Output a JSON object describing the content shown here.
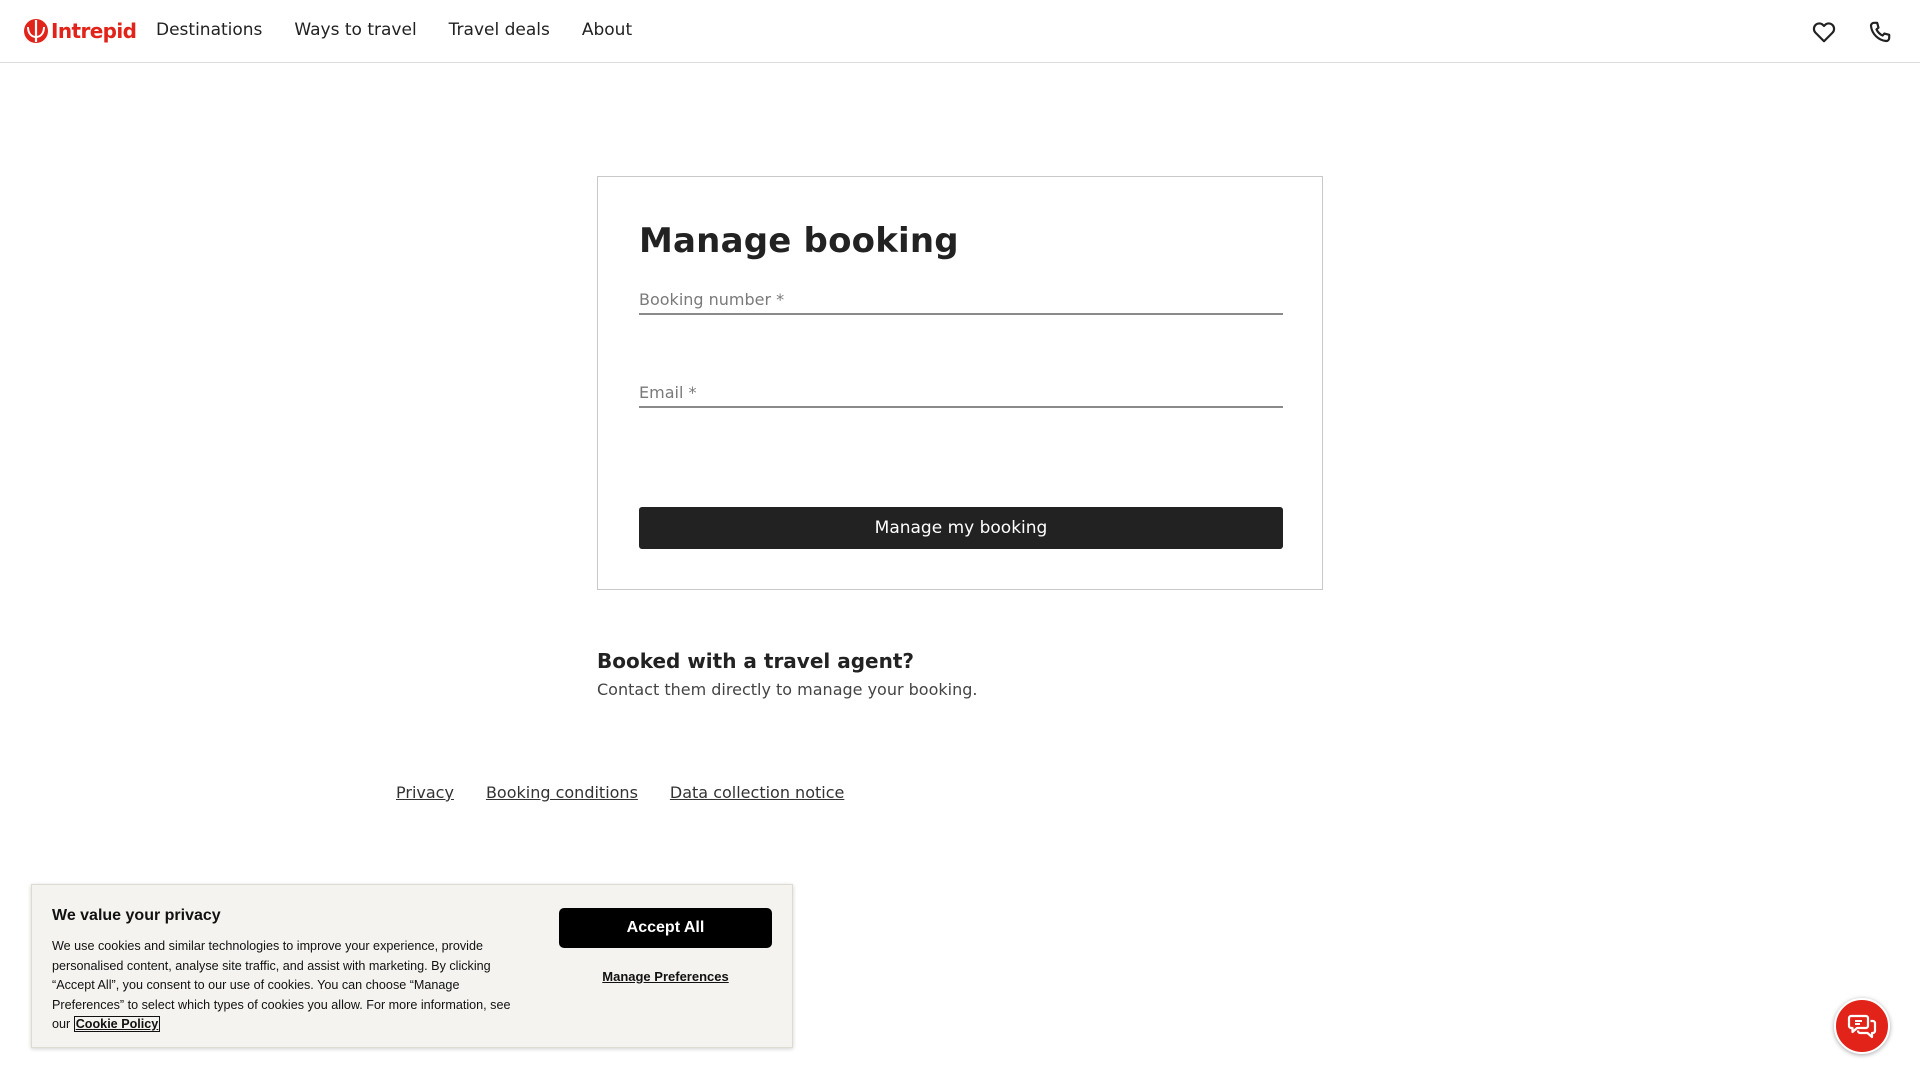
{
  "header": {
    "logo_text": "Intrepid",
    "nav": [
      {
        "label": "Destinations"
      },
      {
        "label": "Ways to travel"
      },
      {
        "label": "Travel deals"
      },
      {
        "label": "About"
      }
    ],
    "icons": [
      "heart-icon",
      "phone-icon"
    ]
  },
  "booking": {
    "title": "Manage booking",
    "booking_number_placeholder": "Booking number *",
    "booking_number_value": "",
    "email_placeholder": "Email *",
    "email_value": "",
    "submit_label": "Manage my booking"
  },
  "agent": {
    "heading": "Booked with a travel agent?",
    "text": "Contact them directly to manage your booking."
  },
  "footer": {
    "links": [
      {
        "label": "Privacy"
      },
      {
        "label": "Booking conditions"
      },
      {
        "label": "Data collection notice"
      }
    ]
  },
  "cookie": {
    "title": "We value your privacy",
    "body": "We use cookies and similar technologies to improve your experience, provide personalised content, analyse site traffic, and assist with marketing. By clicking “Accept All”, you consent to our use of cookies. You can choose “Manage Preferences” to select which types of cookies you allow. For more information, see our",
    "policy_link": "Cookie Policy",
    "accept_label": "Accept All",
    "manage_label": "Manage Preferences"
  },
  "chat": {
    "icon": "chat-icon"
  },
  "colors": {
    "brand": "#e2231a",
    "primary_button": "#222222",
    "cookie_background": "#f4f3ef"
  }
}
